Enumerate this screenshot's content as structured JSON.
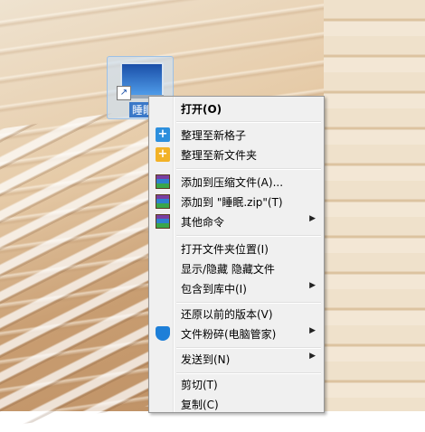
{
  "desktop": {
    "icon_label": "睡眠"
  },
  "menu": {
    "items": [
      {
        "label": "打开(O)",
        "bold": true,
        "icon": "",
        "submenu": false
      },
      {
        "label": "整理至新格子",
        "icon": "plus-blue-icon",
        "submenu": false
      },
      {
        "label": "整理至新文件夹",
        "icon": "plus-gold-icon",
        "submenu": false
      },
      {
        "label": "添加到压缩文件(A)...",
        "icon": "winrar-icon",
        "submenu": false
      },
      {
        "label": "添加到 \"睡眠.zip\"(T)",
        "icon": "winrar-icon",
        "submenu": false
      },
      {
        "label": "其他命令",
        "icon": "winrar-icon",
        "submenu": true
      },
      {
        "label": "打开文件夹位置(I)",
        "icon": "",
        "submenu": false
      },
      {
        "label": "显示/隐藏 隐藏文件",
        "icon": "",
        "submenu": false
      },
      {
        "label": "包含到库中(I)",
        "icon": "",
        "submenu": true
      },
      {
        "label": "还原以前的版本(V)",
        "icon": "",
        "submenu": false
      },
      {
        "label": "文件粉碎(电脑管家)",
        "icon": "shield-icon",
        "submenu": true
      },
      {
        "label": "发送到(N)",
        "icon": "",
        "submenu": true
      },
      {
        "label": "剪切(T)",
        "icon": "",
        "submenu": false
      },
      {
        "label": "复制(C)",
        "icon": "",
        "submenu": false
      }
    ],
    "submenu_arrow": "▶"
  }
}
